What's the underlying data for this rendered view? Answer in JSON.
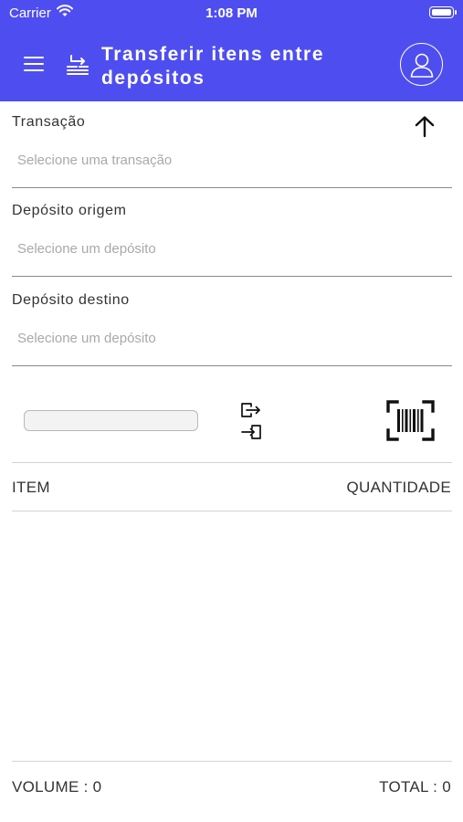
{
  "status_bar": {
    "carrier": "Carrier",
    "time": "1:08 PM"
  },
  "header": {
    "title": "Transferir itens entre depósitos",
    "background_color": "#4e4ef0",
    "menu_icon": "hamburger-menu-icon",
    "transfer_icon": "transfer-list-icon",
    "profile_icon": "user-profile-icon"
  },
  "form": {
    "transaction": {
      "label": "Transação",
      "placeholder": "Selecione uma transação"
    },
    "origin": {
      "label": "Depósito origem",
      "placeholder": "Selecione um depósito"
    },
    "destination": {
      "label": "Depósito destino",
      "placeholder": "Selecione um depósito"
    },
    "collapse_icon": "arrow-up-icon"
  },
  "scan": {
    "input_value": "",
    "export_icon": "export-icon",
    "import_icon": "import-icon",
    "barcode_icon": "barcode-scanner-icon"
  },
  "table": {
    "columns": [
      "ITEM",
      "QUANTIDADE"
    ],
    "rows": []
  },
  "footer": {
    "volume": "VOLUME : 0",
    "total": "TOTAL : 0"
  }
}
